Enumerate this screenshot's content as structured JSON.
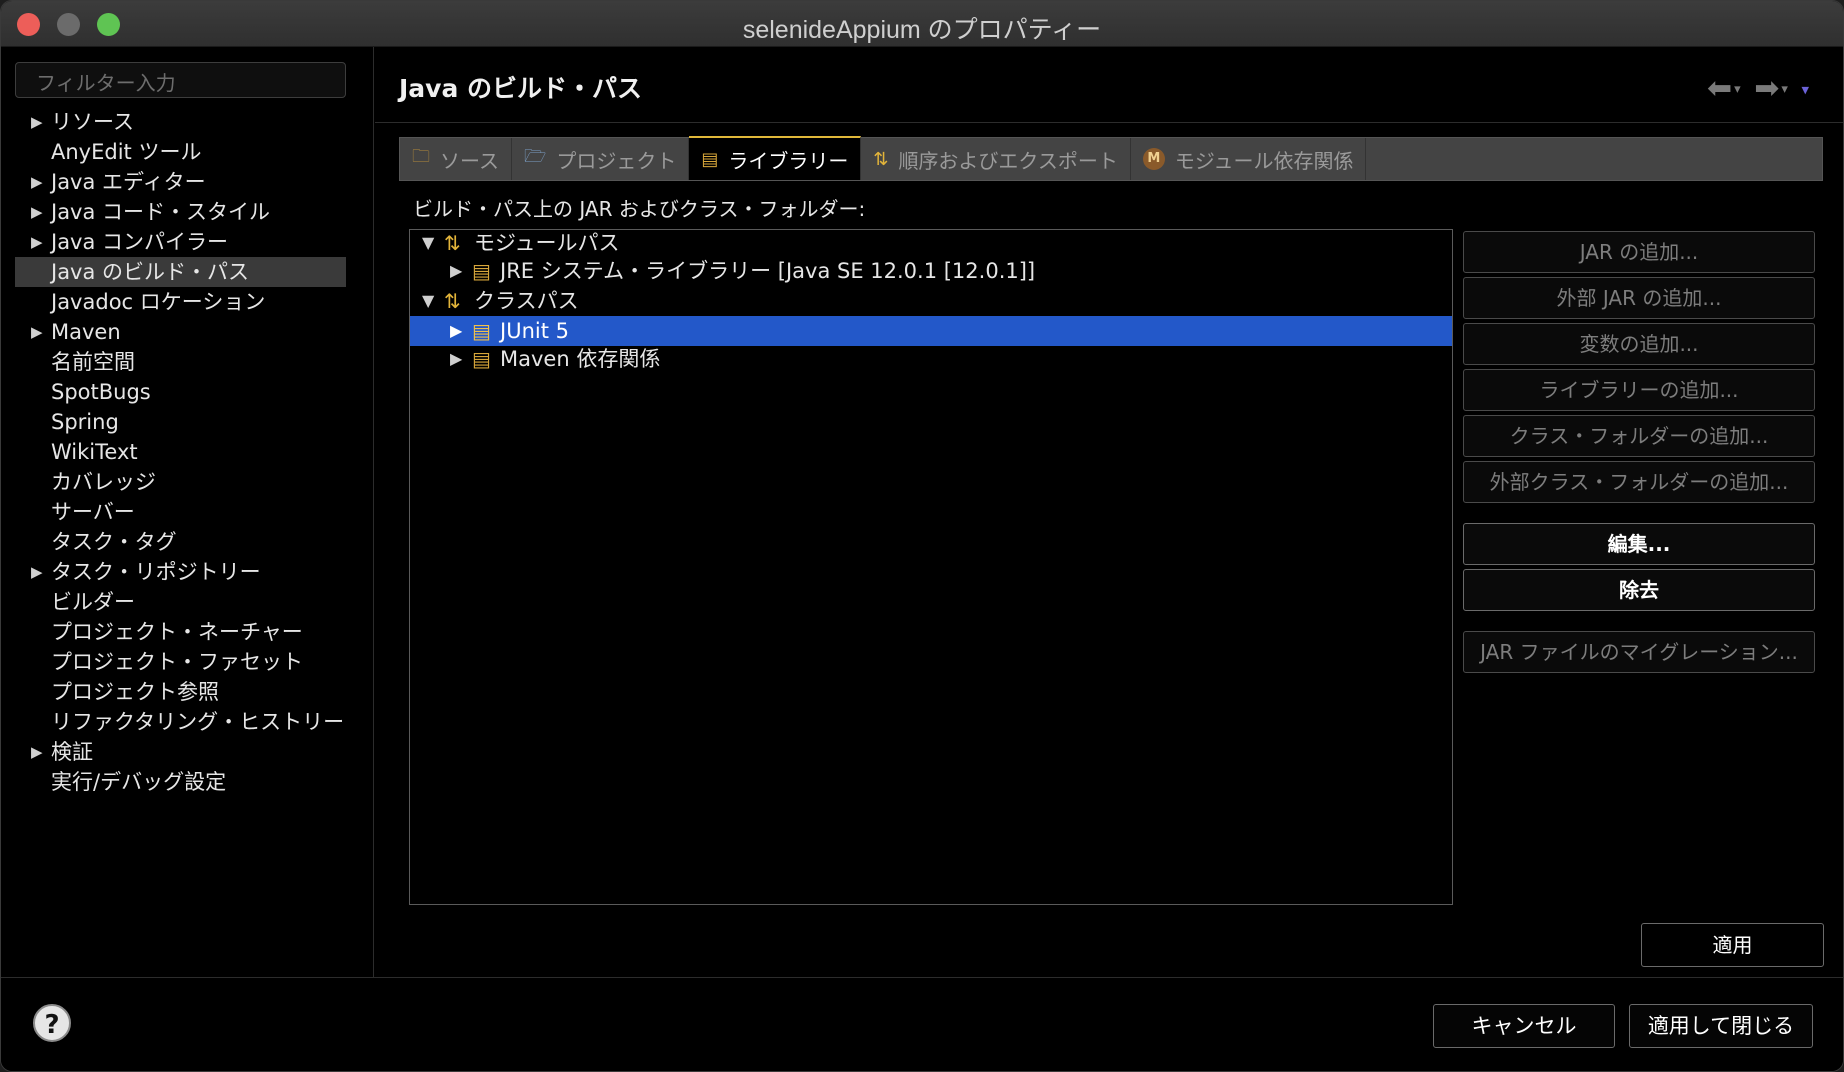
{
  "window": {
    "title": "selenideAppium のプロパティー"
  },
  "sidebar": {
    "filter_placeholder": "フィルター入力",
    "items": [
      {
        "label": "リソース",
        "expandable": true
      },
      {
        "label": "AnyEdit ツール",
        "expandable": false
      },
      {
        "label": "Java エディター",
        "expandable": true
      },
      {
        "label": "Java コード・スタイル",
        "expandable": true
      },
      {
        "label": "Java コンパイラー",
        "expandable": true
      },
      {
        "label": "Java のビルド・パス",
        "expandable": false,
        "selected": true
      },
      {
        "label": "Javadoc ロケーション",
        "expandable": false
      },
      {
        "label": "Maven",
        "expandable": true
      },
      {
        "label": "名前空間",
        "expandable": false
      },
      {
        "label": "SpotBugs",
        "expandable": false
      },
      {
        "label": "Spring",
        "expandable": false
      },
      {
        "label": "WikiText",
        "expandable": false
      },
      {
        "label": "カバレッジ",
        "expandable": false
      },
      {
        "label": "サーバー",
        "expandable": false
      },
      {
        "label": "タスク・タグ",
        "expandable": false
      },
      {
        "label": "タスク・リポジトリー",
        "expandable": true
      },
      {
        "label": "ビルダー",
        "expandable": false
      },
      {
        "label": "プロジェクト・ネーチャー",
        "expandable": false
      },
      {
        "label": "プロジェクト・ファセット",
        "expandable": false
      },
      {
        "label": "プロジェクト参照",
        "expandable": false
      },
      {
        "label": "リファクタリング・ヒストリー",
        "expandable": false
      },
      {
        "label": "検証",
        "expandable": true
      },
      {
        "label": "実行/デバッグ設定",
        "expandable": false
      }
    ]
  },
  "main": {
    "title": "Java のビルド・パス",
    "tabs": [
      {
        "label": "ソース",
        "icon": "source-folder-icon"
      },
      {
        "label": "プロジェクト",
        "icon": "project-folder-icon"
      },
      {
        "label": "ライブラリー",
        "icon": "library-icon",
        "active": true
      },
      {
        "label": "順序およびエクスポート",
        "icon": "order-export-icon"
      },
      {
        "label": "モジュール依存関係",
        "icon": "module-icon"
      }
    ],
    "section_label": "ビルド・パス上の JAR およびクラス・フォルダー:",
    "tree": [
      {
        "label": "モジュールパス",
        "icon": "path-icon",
        "expanded": true
      },
      {
        "label": "JRE システム・ライブラリー [Java SE 12.0.1 [12.0.1]]",
        "icon": "library-icon"
      },
      {
        "label": "クラスパス",
        "icon": "path-icon",
        "expanded": true
      },
      {
        "label": "JUnit 5",
        "icon": "library-icon",
        "selected": true
      },
      {
        "label": "Maven 依存関係",
        "icon": "library-icon"
      }
    ],
    "buttons": [
      {
        "label": "JAR の追加...",
        "enabled": false
      },
      {
        "label": "外部 JAR の追加...",
        "enabled": false
      },
      {
        "label": "変数の追加...",
        "enabled": false
      },
      {
        "label": "ライブラリーの追加...",
        "enabled": false
      },
      {
        "label": "クラス・フォルダーの追加...",
        "enabled": false
      },
      {
        "label": "外部クラス・フォルダーの追加...",
        "enabled": false
      },
      {
        "label": "編集...",
        "enabled": true
      },
      {
        "label": "除去",
        "enabled": true
      },
      {
        "label": "JAR ファイルのマイグレーション...",
        "enabled": false
      }
    ],
    "apply_label": "適用"
  },
  "footer": {
    "help_symbol": "?",
    "cancel_label": "キャンセル",
    "apply_close_label": "適用して閉じる"
  },
  "colors": {
    "selection": "#2358c9",
    "active_tab_accent": "#e0b83a",
    "close": "#ed5e59",
    "maximize": "#5fc453"
  }
}
